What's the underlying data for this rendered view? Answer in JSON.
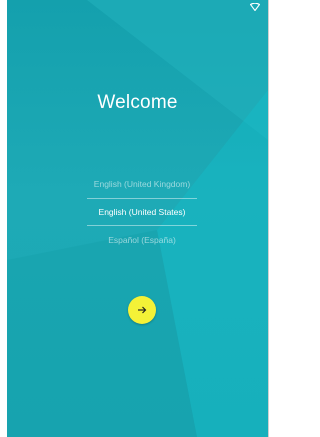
{
  "welcome": {
    "title": "Welcome"
  },
  "languages": [
    {
      "label": "English (United Kingdom)",
      "selected": false
    },
    {
      "label": "English (United States)",
      "selected": true
    },
    {
      "label": "Español (España)",
      "selected": false
    }
  ],
  "next_button": {
    "icon": "arrow-right-icon"
  },
  "status_bar": {
    "icons": [
      "wifi-icon"
    ]
  },
  "colors": {
    "background": "#1aa7b3",
    "accent": "#f4f237",
    "text": "#ffffff"
  }
}
